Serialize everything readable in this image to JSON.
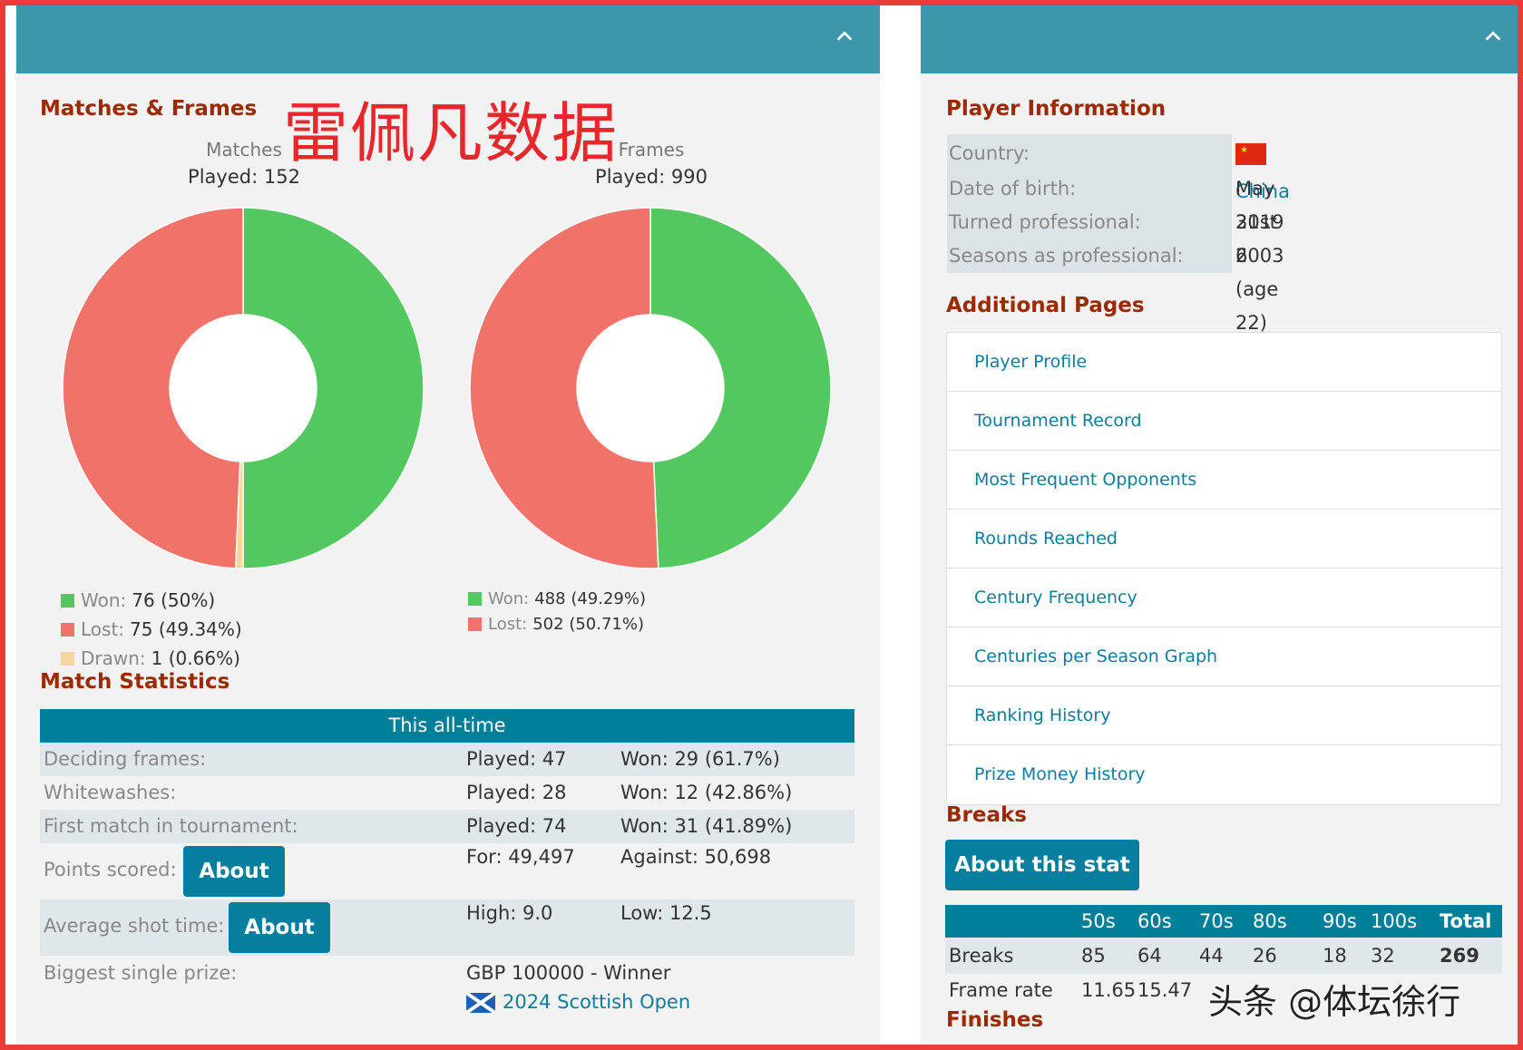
{
  "overlay_text": "雷佩凡数据",
  "watermark": "头条 @体坛徐行",
  "left_panel": {
    "matches_frames_heading": "Matches & Frames",
    "matches_chart": {
      "title": "Matches",
      "played": "Played: 152",
      "legend": [
        {
          "label": "Won:",
          "value": "76 (50%)",
          "color": "#52c85f"
        },
        {
          "label": "Lost:",
          "value": "75 (49.34%)",
          "color": "#f07269"
        },
        {
          "label": "Drawn:",
          "value": "1 (0.66%)",
          "color": "#f5d79a"
        }
      ],
      "slices": [
        76,
        1,
        75
      ]
    },
    "frames_chart": {
      "title": "Frames",
      "played": "Played: 990",
      "legend": [
        {
          "label": "Won:",
          "value": "488 (49.29%)",
          "color": "#52c85f"
        },
        {
          "label": "Lost:",
          "value": "502 (50.71%)",
          "color": "#f07269"
        }
      ],
      "slices": [
        488,
        502
      ]
    },
    "match_statistics_heading": "Match Statistics",
    "stats_header": "This all-time",
    "stats_rows": [
      {
        "label": "Deciding frames:",
        "c2": "Played: 47",
        "c3": "Won: 29 (61.7%)"
      },
      {
        "label": "Whitewashes:",
        "c2": "Played: 28",
        "c3": "Won: 12 (42.86%)"
      },
      {
        "label": "First match in tournament:",
        "c2": "Played: 74",
        "c3": "Won: 31 (41.89%)"
      },
      {
        "label": "Points scored:",
        "button": "About",
        "c2": "For: 49,497",
        "c3": "Against: 50,698"
      },
      {
        "label": "Average shot time:",
        "button": "About",
        "c2": "High: 9.0",
        "c3": "Low: 12.5"
      },
      {
        "label": "Biggest single prize:",
        "c2": "GBP 100000 - Winner",
        "link": "2024 Scottish Open"
      }
    ]
  },
  "right_panel": {
    "player_info_heading": "Player Information",
    "info": [
      {
        "label": "Country:",
        "value": "China"
      },
      {
        "label": "Date of birth:",
        "value": "May 31st 2003 (age 22)"
      },
      {
        "label": "Turned professional:",
        "value": "2019"
      },
      {
        "label": "Seasons as professional:",
        "value": "6"
      }
    ],
    "additional_pages_heading": "Additional Pages",
    "pages": [
      "Player Profile",
      "Tournament Record",
      "Most Frequent Opponents",
      "Rounds Reached",
      "Century Frequency",
      "Centuries per Season Graph",
      "Ranking History",
      "Prize Money History"
    ],
    "breaks_heading": "Breaks",
    "about_stat_button": "About this stat",
    "breaks_columns": [
      "50s",
      "60s",
      "70s",
      "80s",
      "90s",
      "100s",
      "Total"
    ],
    "breaks_row": {
      "label": "Breaks",
      "values": [
        "85",
        "64",
        "44",
        "26",
        "18",
        "32",
        "269"
      ]
    },
    "frame_rate_row": {
      "label": "Frame rate",
      "values": [
        "11.65",
        "15.47"
      ]
    },
    "finishes_heading": "Finishes"
  },
  "colors": {
    "header_bar": "#3d97ab",
    "heading": "#9c2a00",
    "link": "#0b7d9b",
    "table_head": "#007f9a",
    "won": "#52c85f",
    "lost": "#f07269",
    "drawn": "#f5d79a"
  }
}
